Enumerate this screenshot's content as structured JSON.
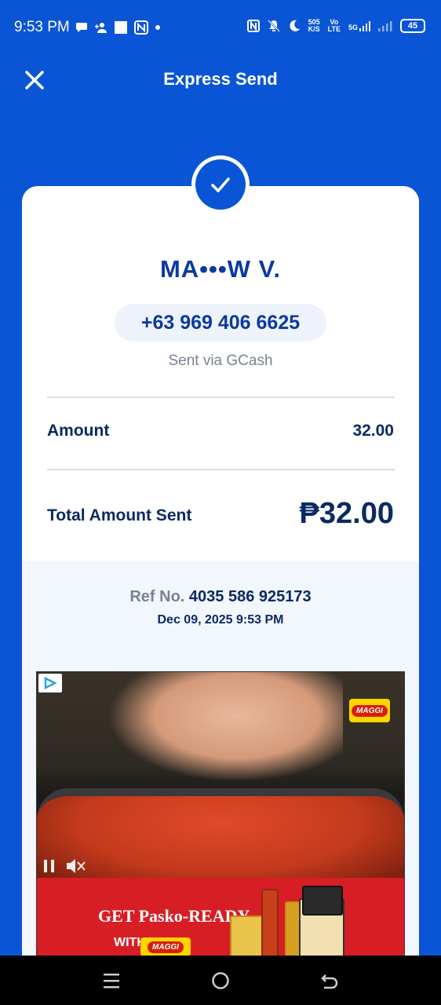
{
  "status_bar": {
    "time": "9:53 PM",
    "net_speed_top": "505",
    "net_speed_bottom": "K/S",
    "volte_top": "Vo",
    "volte_bottom": "LTE",
    "network": "5G",
    "battery": "45"
  },
  "header": {
    "title": "Express Send",
    "close_icon": "close-icon"
  },
  "receipt": {
    "recipient_name": "MA•••W V.",
    "phone": "+63 969 406 6625",
    "sent_via": "Sent via GCash",
    "amount_label": "Amount",
    "amount_value": "32.00",
    "total_label": "Total Amount Sent",
    "total_value": "₱32.00",
    "ref_label": "Ref No.",
    "ref_number": "4035 586 925173",
    "date": "Dec 09, 2025 9:53 PM"
  },
  "ad": {
    "brand": "MAGGI",
    "banner_line1": "GET Pasko-READY",
    "banner_line2": "WITH"
  },
  "colors": {
    "primary": "#0a55d6",
    "navy": "#0b2a63",
    "muted": "#7a8290"
  }
}
